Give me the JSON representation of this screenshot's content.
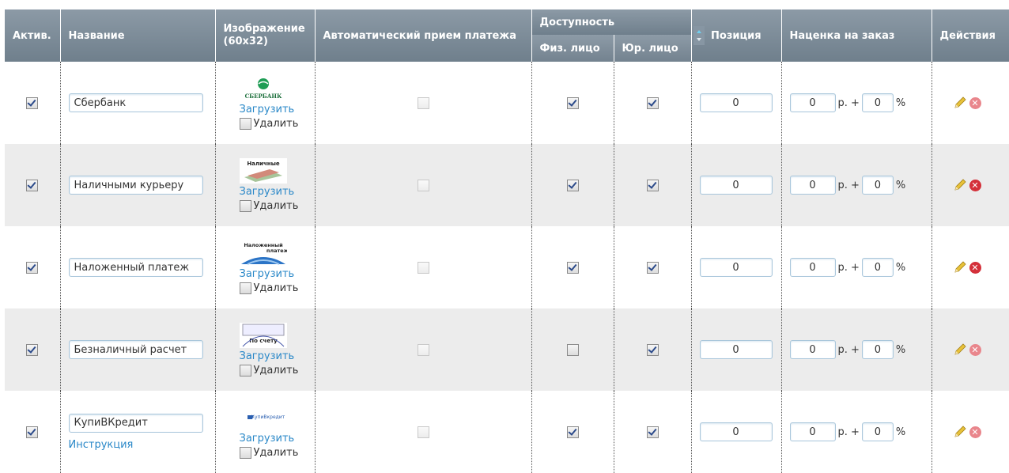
{
  "header": {
    "active": "Актив.",
    "name": "Название",
    "image": "Изображение (60x32)",
    "auto": "Автоматический прием платежа",
    "availability": "Доступность",
    "phys": "Физ. лицо",
    "jur": "Юр. лицо",
    "position": "Позиция",
    "markup": "Наценка на заказ",
    "actions": "Действия"
  },
  "upload_label": "Загрузить",
  "delete_label": "Удалить",
  "rub_label": "р. +",
  "percent_label": "%",
  "rows": [
    {
      "name": "Сбербанк",
      "active": true,
      "auto": false,
      "phys": true,
      "jur": true,
      "position": "0",
      "markup_rub": "0",
      "markup_pct": "0",
      "image_text": "СБЕРБАНК",
      "extra_link": ""
    },
    {
      "name": "Наличными курьеру",
      "active": true,
      "auto": false,
      "phys": true,
      "jur": true,
      "position": "0",
      "markup_rub": "0",
      "markup_pct": "0",
      "image_text": "Наличные",
      "extra_link": ""
    },
    {
      "name": "Наложенный платеж",
      "active": true,
      "auto": false,
      "phys": true,
      "jur": true,
      "position": "0",
      "markup_rub": "0",
      "markup_pct": "0",
      "image_text": "Наложенный платеж",
      "extra_link": ""
    },
    {
      "name": "Безналичный расчет",
      "active": true,
      "auto": false,
      "phys": false,
      "jur": true,
      "position": "0",
      "markup_rub": "0",
      "markup_pct": "0",
      "image_text": "По счету",
      "extra_link": ""
    },
    {
      "name": "КупиВКредит",
      "active": true,
      "auto": false,
      "phys": true,
      "jur": true,
      "position": "0",
      "markup_rub": "0",
      "markup_pct": "0",
      "image_text": "КупиВкредит",
      "extra_link": "Инструкция"
    }
  ],
  "colors": {
    "header_bg": "#7b8a97",
    "link": "#2a88c8",
    "delete_icon": "#d4303a"
  }
}
